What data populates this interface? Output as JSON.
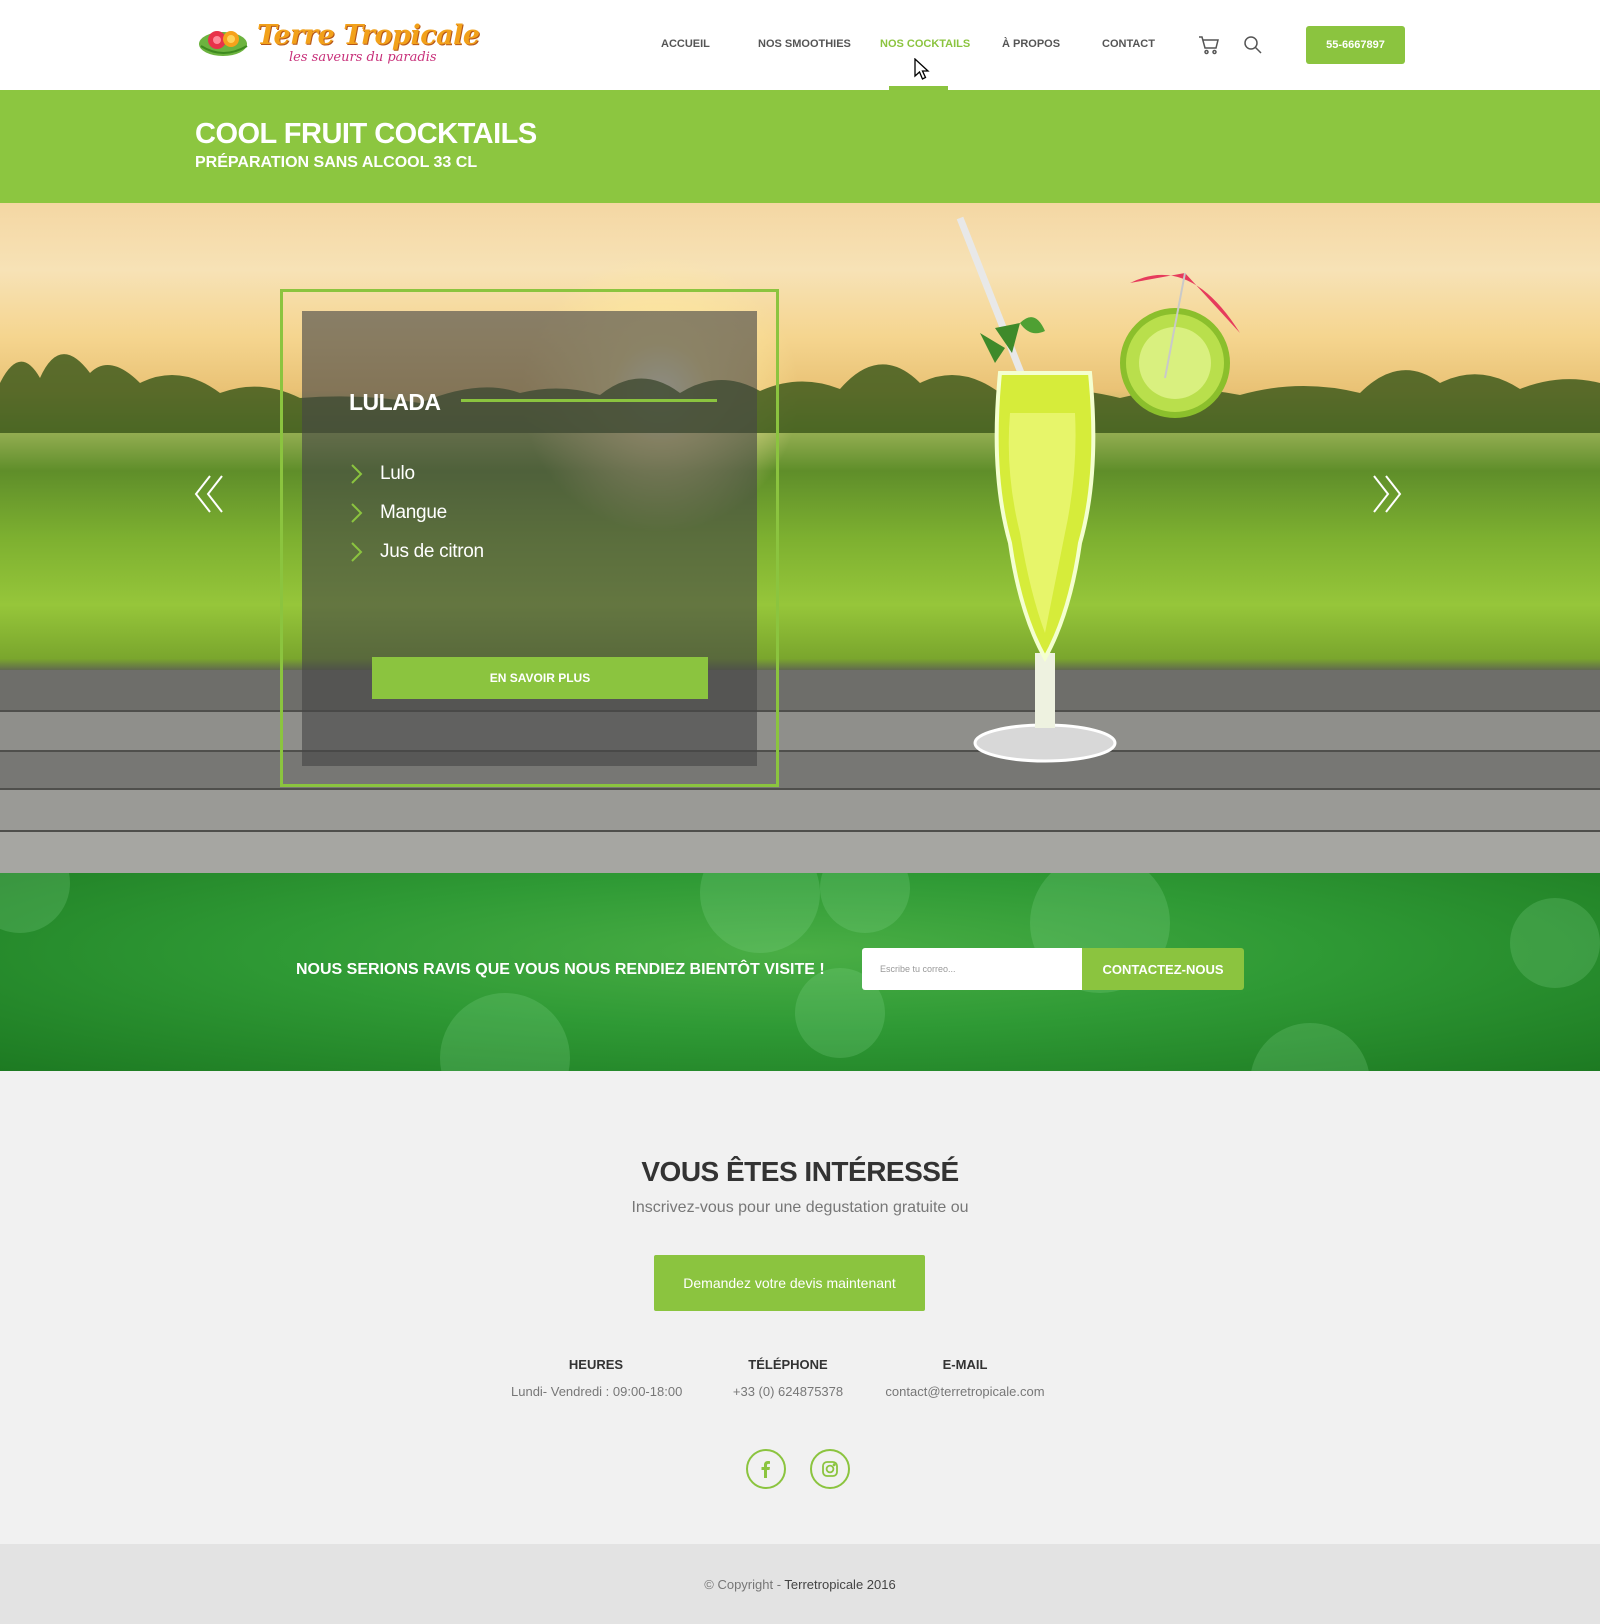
{
  "brand": {
    "name": "Terre Tropicale",
    "tagline": "les saveurs du paradis"
  },
  "nav": {
    "items": [
      {
        "label": "ACCUEIL",
        "active": false
      },
      {
        "label": "NOS SMOOTHIES",
        "active": false
      },
      {
        "label": "NOS COCKTAILS",
        "active": true
      },
      {
        "label": "À PROPOS",
        "active": false
      },
      {
        "label": "CONTACT",
        "active": false
      }
    ],
    "cart_icon": "cart-icon",
    "search_icon": "search-icon",
    "phone": "55-6667897"
  },
  "colors": {
    "accent": "#8bc43f",
    "band": "#8cc640",
    "newsletter": "#2f9a35",
    "footer": "#e3e3e3"
  },
  "page": {
    "title": "COOL FRUIT COCKTAILS",
    "subtitle": "PRÉPARATION SANS ALCOOL 33 CL"
  },
  "slide": {
    "name": "LULADA",
    "ingredients": [
      "Lulo",
      "Mangue",
      "Jus de citron"
    ],
    "button": "EN SAVOIR PLUS",
    "prev_icon": "double-chevron-left-icon",
    "next_icon": "double-chevron-right-icon"
  },
  "newsletter": {
    "text": "NOUS SERIONS RAVIS QUE VOUS NOUS RENDIEZ BIENTÔT VISITE !",
    "placeholder": "Escribe tu correo...",
    "button": "CONTACTEZ-NOUS"
  },
  "interest": {
    "title": "VOUS ÊTES INTÉRESSÉ",
    "subtitle": "Inscrivez-vous pour une degustation gratuite ou",
    "button": "Demandez votre devis maintenant"
  },
  "contact": [
    {
      "label": "HEURES",
      "value": "Lundi- Vendredi : 09:00-18:00"
    },
    {
      "label": "TÉLÉPHONE",
      "value": "+33 (0) 624875378"
    },
    {
      "label": "E-MAIL",
      "value": "contact@terretropicale.com"
    }
  ],
  "social": [
    "facebook-icon",
    "instagram-icon"
  ],
  "footer": {
    "prefix": "© Copyright - ",
    "owner": "Terretropicale 2016"
  }
}
